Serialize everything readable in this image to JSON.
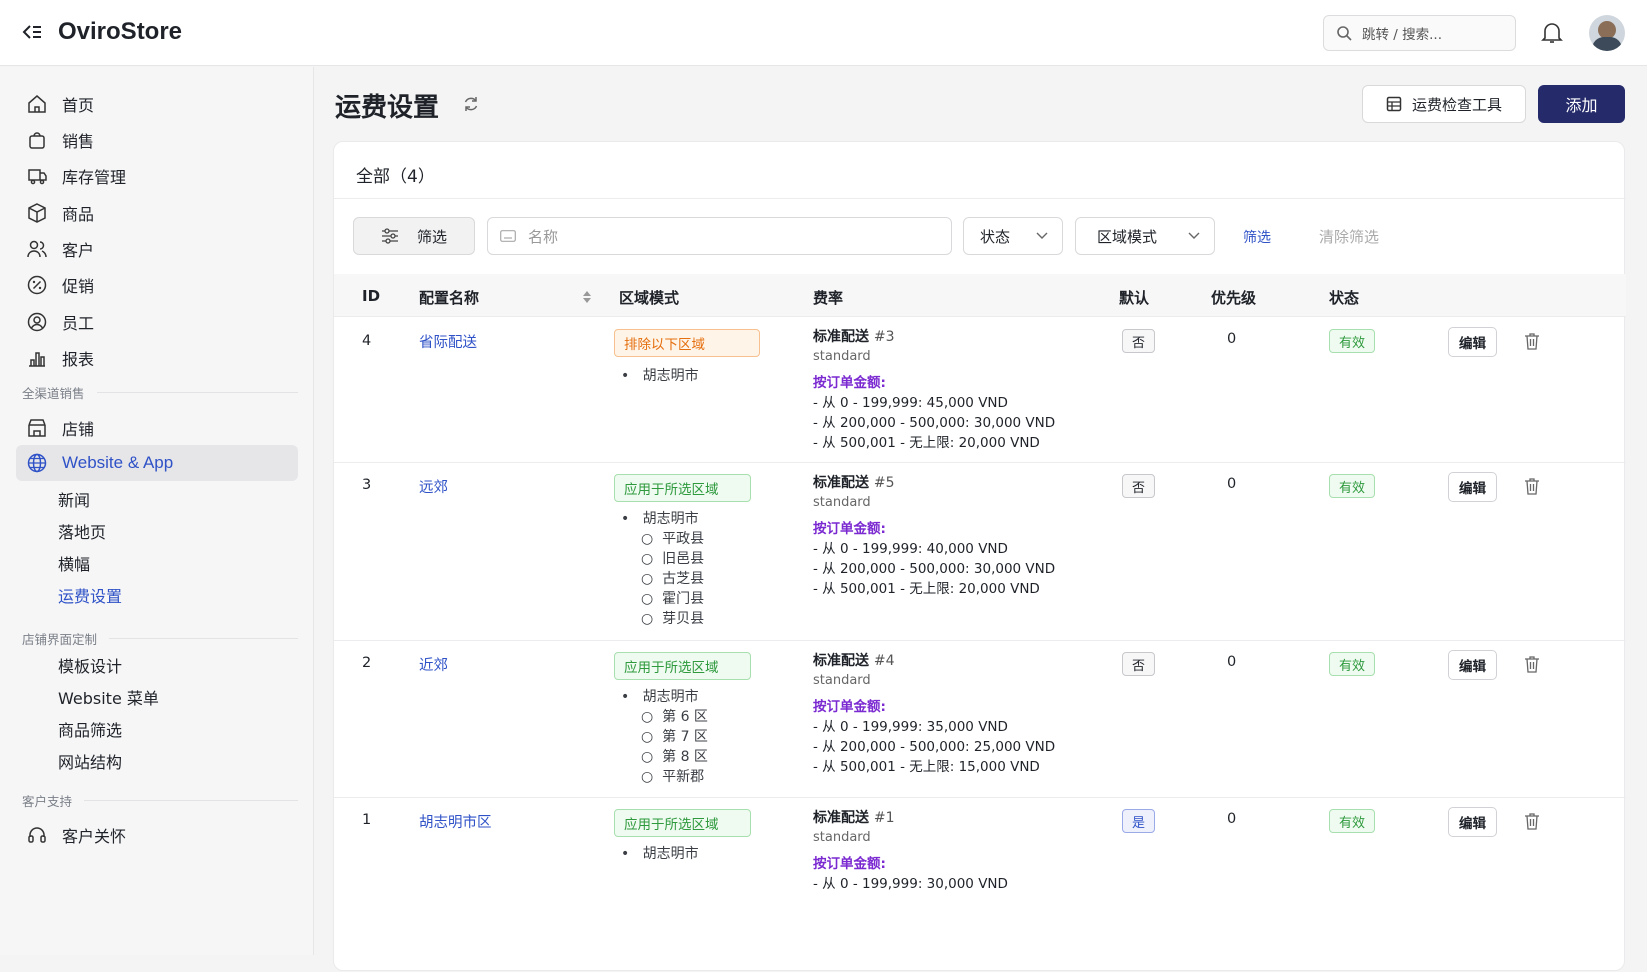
{
  "app": {
    "title": "OviroStore",
    "search_placeholder": "跳转 / 搜索..."
  },
  "sidebar": {
    "items": [
      {
        "label": "首页"
      },
      {
        "label": "销售"
      },
      {
        "label": "库存管理"
      },
      {
        "label": "商品"
      },
      {
        "label": "客户"
      },
      {
        "label": "促销"
      },
      {
        "label": "员工"
      },
      {
        "label": "报表"
      }
    ],
    "group1": "全渠道销售",
    "store": "店铺",
    "website": "Website & App",
    "website_sub": [
      {
        "label": "新闻"
      },
      {
        "label": "落地页"
      },
      {
        "label": "横幅"
      },
      {
        "label": "运费设置"
      }
    ],
    "group2": "店铺界面定制",
    "custom_sub": [
      {
        "label": "模板设计"
      },
      {
        "label": "Website 菜单"
      },
      {
        "label": "商品筛选"
      },
      {
        "label": "网站结构"
      }
    ],
    "group3": "客户支持",
    "care": "客户关怀"
  },
  "page": {
    "title": "运费设置",
    "check_tool": "运费检查工具",
    "add": "添加",
    "tab": "全部（4）"
  },
  "filters": {
    "filter_btn": "筛选",
    "name_placeholder": "名称",
    "status": "状态",
    "zone_mode": "区域模式",
    "apply": "筛选",
    "clear": "清除筛选"
  },
  "table": {
    "headers": [
      "ID",
      "配置名称",
      "区域模式",
      "费率",
      "默认",
      "优先级",
      "状态"
    ],
    "rows": [
      {
        "id": "4",
        "name": "省际配送",
        "mode": "排除以下区域",
        "region": "胡志明市",
        "districts": [],
        "rate_name": "标准配送",
        "rate_no": "#3",
        "rate_code": "standard",
        "price_label": "按订单金额:",
        "tiers": [
          "- 从 0 - 199,999: 45,000 VND",
          "- 从 200,000 - 500,000: 30,000 VND",
          "- 从 500,001 - 无上限: 20,000 VND"
        ],
        "default": "否",
        "priority": "0",
        "status": "有效",
        "edit": "编辑"
      },
      {
        "id": "3",
        "name": "远郊",
        "mode": "应用于所选区域",
        "region": "胡志明市",
        "districts": [
          "平政县",
          "旧邑县",
          "古芝县",
          "霍门县",
          "芽贝县"
        ],
        "rate_name": "标准配送",
        "rate_no": "#5",
        "rate_code": "standard",
        "price_label": "按订单金额:",
        "tiers": [
          "- 从 0 - 199,999: 40,000 VND",
          "- 从 200,000 - 500,000: 30,000 VND",
          "- 从 500,001 - 无上限: 20,000 VND"
        ],
        "default": "否",
        "priority": "0",
        "status": "有效",
        "edit": "编辑"
      },
      {
        "id": "2",
        "name": "近郊",
        "mode": "应用于所选区域",
        "region": "胡志明市",
        "districts": [
          "第 6 区",
          "第 7 区",
          "第 8 区",
          "平新郡"
        ],
        "rate_name": "标准配送",
        "rate_no": "#4",
        "rate_code": "standard",
        "price_label": "按订单金额:",
        "tiers": [
          "- 从 0 - 199,999: 35,000 VND",
          "- 从 200,000 - 500,000: 25,000 VND",
          "- 从 500,001 - 无上限: 15,000 VND"
        ],
        "default": "否",
        "priority": "0",
        "status": "有效",
        "edit": "编辑"
      },
      {
        "id": "1",
        "name": "胡志明市区",
        "mode": "应用于所选区域",
        "region": "胡志明市",
        "districts": [],
        "rate_name": "标准配送",
        "rate_no": "#1",
        "rate_code": "standard",
        "price_label": "按订单金额:",
        "tiers": [
          "- 从 0 - 199,999: 30,000 VND"
        ],
        "default": "是",
        "priority": "0",
        "status": "有效",
        "edit": "编辑"
      }
    ]
  },
  "colors": {
    "primary": "#252a6b",
    "link": "#2f52c7",
    "active_bg": "#e6e6e9"
  }
}
